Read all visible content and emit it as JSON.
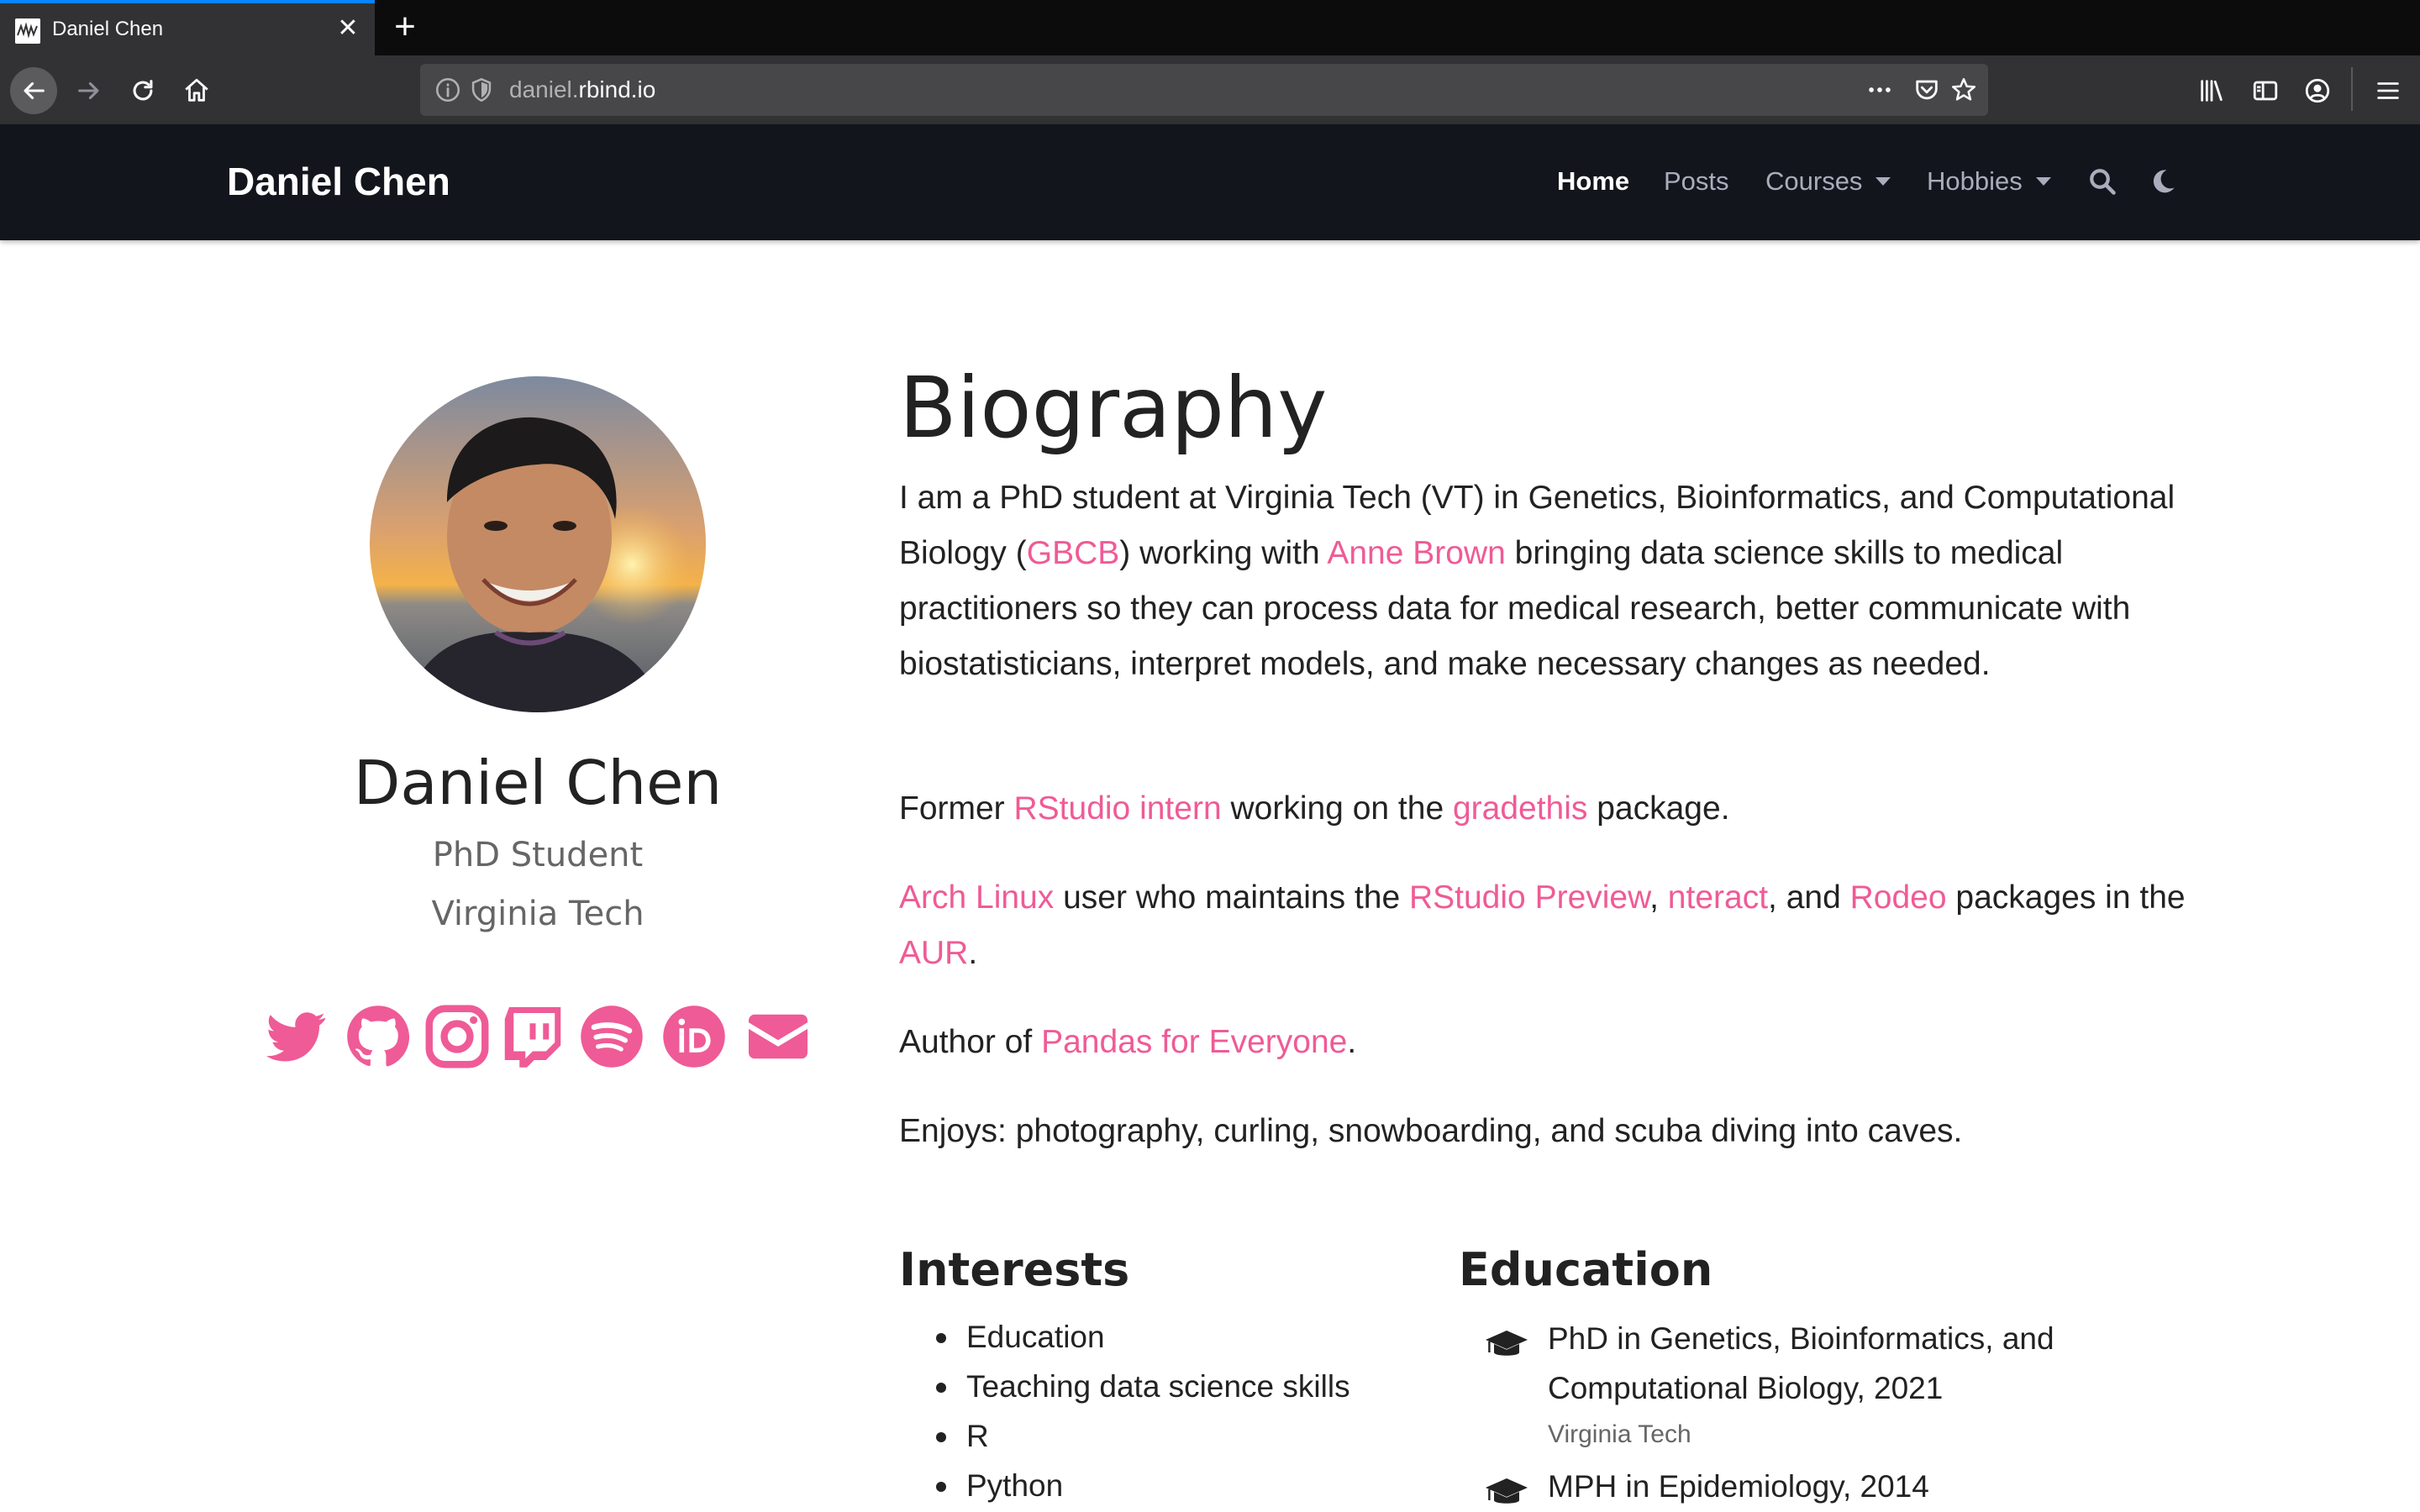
{
  "browser": {
    "tab_title": "Daniel Chen",
    "url_prefix": "daniel.",
    "url_domain": "rbind.io",
    "accent": "#0a84ff"
  },
  "site": {
    "brand": "Daniel Chen",
    "nav": {
      "home": "Home",
      "posts": "Posts",
      "courses": "Courses",
      "hobbies": "Hobbies"
    },
    "link_color": "#ef5b96",
    "nav_bg": "#13151d"
  },
  "profile": {
    "name": "Daniel Chen",
    "role": "PhD Student",
    "org": "Virginia Tech",
    "socials": [
      "twitter-icon",
      "github-icon",
      "instagram-icon",
      "twitch-icon",
      "spotify-icon",
      "orcid-icon",
      "email-icon"
    ]
  },
  "biography": {
    "title": "Biography",
    "p1": {
      "t1": "I am a PhD student at Virginia Tech (VT) in Genetics, Bioinformatics, and Computational Biology (",
      "l1": "GBCB",
      "t2": ") working with ",
      "l2": "Anne Brown",
      "t3": " bringing data science skills to medical practitioners so they can process data for medical research, better communicate with biostatisticians, interpret models, and make necessary changes as needed."
    },
    "p2": {
      "t1": "Former ",
      "l1": "RStudio intern",
      "t2": " working on the ",
      "l2": "gradethis",
      "t3": " package."
    },
    "p3": {
      "l1": "Arch Linux",
      "t1": " user who maintains the ",
      "l2": "RStudio Preview",
      "t2": ", ",
      "l3": "nteract",
      "t3": ", and ",
      "l4": "Rodeo",
      "t4": " packages in the ",
      "l5": "AUR",
      "t5": "."
    },
    "p4": {
      "t1": "Author of ",
      "l1": "Pandas for Everyone",
      "t2": "."
    },
    "p5": "Enjoys: photography, curling, snowboarding, and scuba diving into caves."
  },
  "interests": {
    "title": "Interests",
    "items": [
      "Education",
      "Teaching data science skills",
      "R",
      "Python"
    ]
  },
  "education": {
    "title": "Education",
    "items": [
      {
        "degree": "PhD in Genetics, Bioinformatics, and Computational Biology, 2021",
        "institution": "Virginia Tech"
      },
      {
        "degree": "MPH in Epidemiology, 2014",
        "institution": ""
      }
    ]
  }
}
